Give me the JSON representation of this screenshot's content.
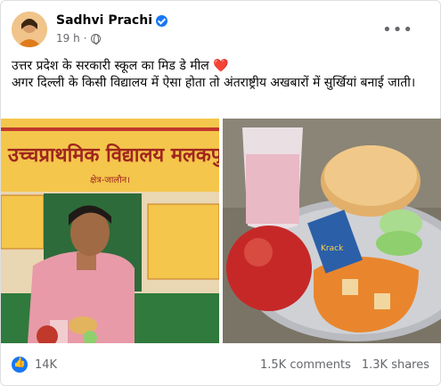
{
  "post": {
    "author": "Sadhvi Prachi",
    "time": "19 h",
    "text_line1": "उत्तर प्रदेश के सरकारी स्कूल का मिड डे मील",
    "text_line2": "अगर दिल्ली के किसी विद्यालय में ऐसा होता तो अंतराष्ट्रीय अखबारों में सुर्खियां बनाई जाती।",
    "school_sign": "उच्चप्राथमिक विद्यालय मलकपु",
    "school_sub": "क्षेत्र-जालौन।"
  },
  "reactions": {
    "count": "14K",
    "comments": "1.5K comments",
    "shares": "1.3K shares"
  },
  "colors": {
    "brand": "#1877f2",
    "heart": "#e41e3f"
  }
}
